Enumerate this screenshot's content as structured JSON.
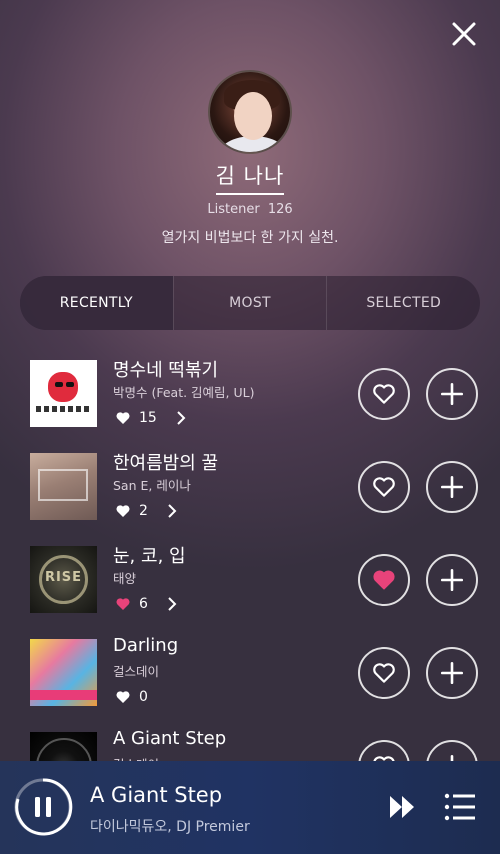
{
  "profile": {
    "name": "김 나나",
    "listener_label": "Listener",
    "listener_count": "126",
    "motto": "열가지 비법보다 한 가지 실천."
  },
  "tabs": [
    {
      "label": "RECENTLY",
      "active": true
    },
    {
      "label": "MOST",
      "active": false
    },
    {
      "label": "SELECTED",
      "active": false
    }
  ],
  "songs": [
    {
      "title": "명수네 떡볶기",
      "artist": "박명수 (Feat. 김예림, UL)",
      "likes": "15",
      "liked": false
    },
    {
      "title": "한여름밤의 꿀",
      "artist": "San E, 레이나",
      "likes": "2",
      "liked": false
    },
    {
      "title": "눈, 코, 입",
      "artist": "태양",
      "likes": "6",
      "liked": true,
      "cover_text": "RISE"
    },
    {
      "title": "Darling",
      "artist": "걸스데이",
      "likes": "0",
      "liked": false
    },
    {
      "title": "A Giant Step",
      "artist": "걸스데이",
      "likes": "",
      "liked": false
    }
  ],
  "player": {
    "title": "A Giant Step",
    "artist": "다이나믹듀오, DJ Premier",
    "state": "playing"
  },
  "colors": {
    "liked_heart": "#e8437a",
    "player_bg": "#203363"
  }
}
